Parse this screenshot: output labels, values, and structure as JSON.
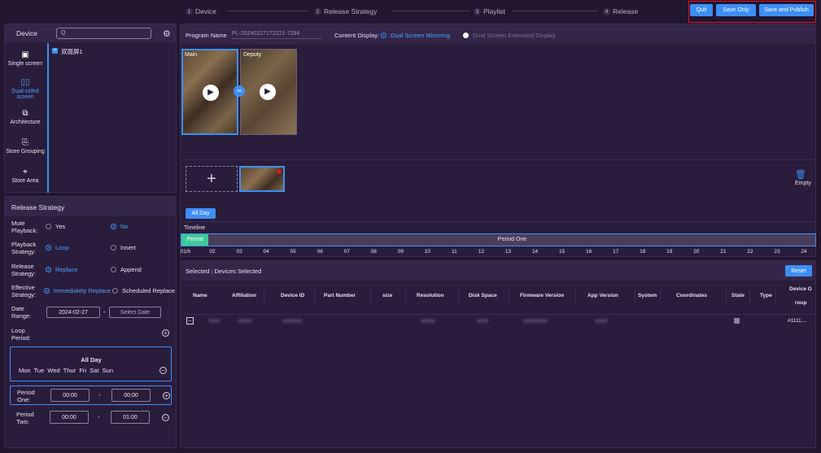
{
  "steps": [
    {
      "num": "1",
      "label": "Device"
    },
    {
      "num": "2",
      "label": "Release Strategy"
    },
    {
      "num": "3",
      "label": "Playlist"
    },
    {
      "num": "4",
      "label": "Release"
    }
  ],
  "top_actions": {
    "quit": "Quit",
    "save_only": "Save Only",
    "save_publish": "Save and Publish"
  },
  "device": {
    "title": "Device",
    "search_placeholder": "Q",
    "tree_item": "双面屏1"
  },
  "sidebar": [
    {
      "label": "Single screen",
      "icon": "monitor-icon"
    },
    {
      "label": "Dual-sided screen",
      "icon": "dual-screen-icon"
    },
    {
      "label": "Architecture",
      "icon": "hierarchy-icon"
    },
    {
      "label": "Store Grouping",
      "icon": "copy-icon"
    },
    {
      "label": "Store Area",
      "icon": "location-pin-icon"
    }
  ],
  "strategy": {
    "title": "Release Strategy",
    "mute": {
      "label": "Mute Playback:",
      "yes": "Yes",
      "no": "No"
    },
    "playback": {
      "label": "Playback Strategy:",
      "loop": "Loop",
      "insert": "Insert"
    },
    "release": {
      "label": "Release Strategy:",
      "replace": "Replace",
      "append": "Append"
    },
    "effective": {
      "label": "Effective Strategy:",
      "immediate": "Immediately Replace",
      "scheduled": "Scheduled Replace"
    },
    "date": {
      "label": "Date Range:",
      "start": "2024-02-27",
      "sep": "-",
      "end_placeholder": "Select Date"
    },
    "loop_period": {
      "label": "Loop Period:"
    },
    "all_day": {
      "title": "All Day",
      "days": "Mon  Tue  Wed  Thur  Fri  Sat  Sun"
    },
    "periods": [
      {
        "label": "Period One:",
        "start": "00:00",
        "end": "00:00"
      },
      {
        "label": "Period Two:",
        "start": "00:00",
        "end": "01:00"
      }
    ]
  },
  "program": {
    "name_label": "Program Name",
    "name_value": "PL-20240227172221-7284",
    "display_label": "Content Display:",
    "mirroring": "Dual Screen Mirroring",
    "extended": "Dual Screen Extended Display"
  },
  "preview": {
    "main": "Main",
    "deputy": "Deputy"
  },
  "playlist": {
    "empty": "Empty",
    "all_day_tab": "All Day"
  },
  "timeline": {
    "label": "Timeline",
    "period_tag": "Period",
    "period_name": "Period One",
    "hours": [
      "01/h",
      "02",
      "03",
      "04",
      "05",
      "06",
      "07",
      "08",
      "09",
      "10",
      "11",
      "12",
      "13",
      "14",
      "15",
      "16",
      "17",
      "18",
      "19",
      "20",
      "21",
      "22",
      "23",
      "24"
    ]
  },
  "devices": {
    "selected": "Selected",
    "sep": "|",
    "devices_selected": "Devices Selected",
    "reset": "Reset",
    "columns": [
      "Name",
      "Affiliation",
      "Device ID",
      "Part Number",
      "size",
      "Resolution",
      "Disk Space",
      "Firmware Version",
      "App Version",
      "System",
      "Coordinates",
      "State",
      "Type",
      "Device G",
      "roup"
    ],
    "row_group_value": "#1111,..."
  },
  "colors": {
    "accent": "#3d8ff5",
    "highlight": "#e0141e",
    "period": "#3ec99a"
  }
}
